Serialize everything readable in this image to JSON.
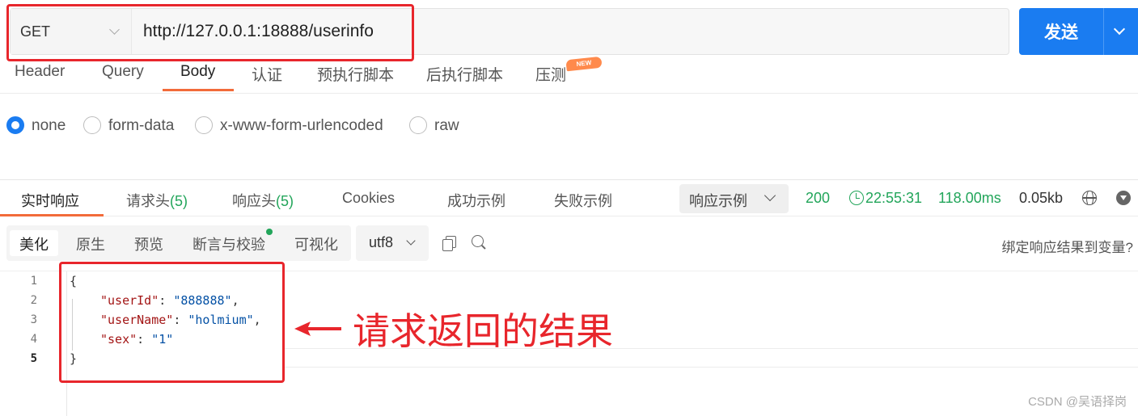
{
  "request": {
    "method": "GET",
    "url": "http://127.0.0.1:18888/userinfo",
    "send_label": "发送"
  },
  "request_tabs": [
    {
      "label": "Header"
    },
    {
      "label": "Query"
    },
    {
      "label": "Body",
      "active": true
    },
    {
      "label": "认证"
    },
    {
      "label": "预执行脚本"
    },
    {
      "label": "后执行脚本"
    },
    {
      "label": "压测",
      "badge": "NEW"
    }
  ],
  "body_types": [
    {
      "label": "none",
      "checked": true
    },
    {
      "label": "form-data"
    },
    {
      "label": "x-www-form-urlencoded"
    },
    {
      "label": "raw"
    }
  ],
  "response_tabs": [
    {
      "label": "实时响应",
      "active": true
    },
    {
      "label": "请求头",
      "count": "(5)"
    },
    {
      "label": "响应头",
      "count": "(5)"
    },
    {
      "label": "Cookies"
    },
    {
      "label": "成功示例"
    },
    {
      "label": "失败示例"
    }
  ],
  "response_meta": {
    "example_select": "响应示例",
    "status": "200",
    "time": "22:55:31",
    "duration": "118.00ms",
    "size": "0.05kb"
  },
  "view_modes": [
    {
      "label": "美化",
      "active": true
    },
    {
      "label": "原生"
    },
    {
      "label": "预览"
    },
    {
      "label": "断言与校验"
    },
    {
      "label": "可视化"
    }
  ],
  "encoding": "utf8",
  "bind_link": "绑定响应结果到变量?",
  "code": {
    "line_numbers": [
      "1",
      "2",
      "3",
      "4",
      "5"
    ],
    "open_brace": "{",
    "close_brace": "}",
    "fields": [
      {
        "key": "\"userId\"",
        "value": "\"888888\"",
        "sep": ","
      },
      {
        "key": "\"userName\"",
        "value": "\"holmium\"",
        "sep": ","
      },
      {
        "key": "\"sex\"",
        "value": "\"1\"",
        "sep": ""
      }
    ]
  },
  "annotation": "请求返回的结果",
  "watermark": "CSDN @吴语择岗",
  "colors": {
    "accent": "#1a7cf1",
    "tab_underline": "#f26b3a",
    "status_green": "#22a55a",
    "annotation_red": "#e8262c"
  }
}
